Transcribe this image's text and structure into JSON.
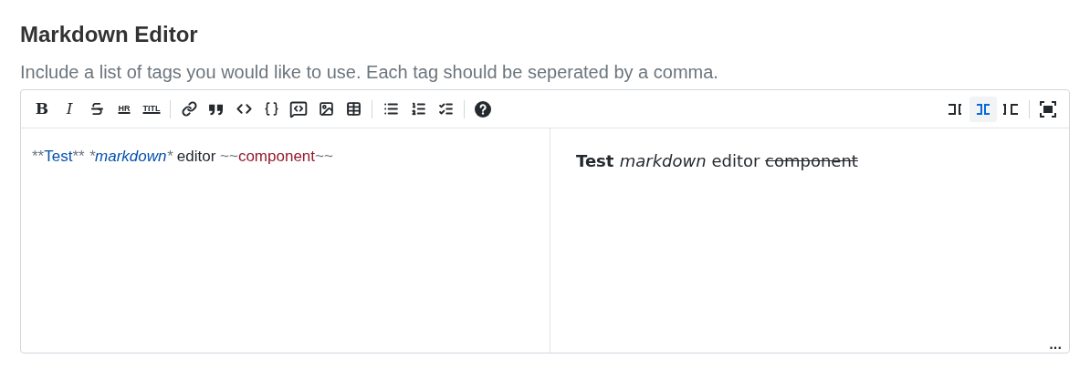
{
  "heading": "Markdown Editor",
  "description": "Include a list of tags you would like to use. Each tag should be seperated by a comma.",
  "toolbar": {
    "groups": [
      [
        {
          "kind": "bold-letter",
          "label": "B"
        },
        {
          "kind": "italic-letter",
          "label": "I"
        },
        {
          "kind": "strike"
        },
        {
          "kind": "small-letters",
          "label": "HR"
        },
        {
          "kind": "small-letters",
          "label": "TITL"
        }
      ],
      [
        {
          "kind": "link"
        },
        {
          "kind": "quote"
        },
        {
          "kind": "code"
        },
        {
          "kind": "braces"
        },
        {
          "kind": "code-bubble"
        },
        {
          "kind": "image"
        },
        {
          "kind": "table"
        }
      ],
      [
        {
          "kind": "bullets"
        },
        {
          "kind": "numbers"
        },
        {
          "kind": "checks"
        }
      ],
      [
        {
          "kind": "help"
        }
      ]
    ],
    "modes": [
      {
        "kind": "editor",
        "selected": false
      },
      {
        "kind": "split",
        "selected": true
      },
      {
        "kind": "preview",
        "selected": false
      }
    ]
  },
  "source": [
    {
      "kind": "mark",
      "text": "**"
    },
    {
      "kind": "strong",
      "text": "Test"
    },
    {
      "kind": "mark",
      "text": "** "
    },
    {
      "kind": "mark-em",
      "text": "*"
    },
    {
      "kind": "em",
      "text": "markdown"
    },
    {
      "kind": "mark-em",
      "text": "*"
    },
    {
      "kind": "plain",
      "text": " editor "
    },
    {
      "kind": "mark",
      "text": "~~"
    },
    {
      "kind": "strike",
      "text": "component"
    },
    {
      "kind": "mark",
      "text": "~~"
    }
  ],
  "preview": [
    {
      "kind": "bold",
      "text": "Test "
    },
    {
      "kind": "italic",
      "text": "markdown"
    },
    {
      "kind": "plain",
      "text": " editor "
    },
    {
      "kind": "strike",
      "text": "component"
    }
  ],
  "resize_handle": "..."
}
